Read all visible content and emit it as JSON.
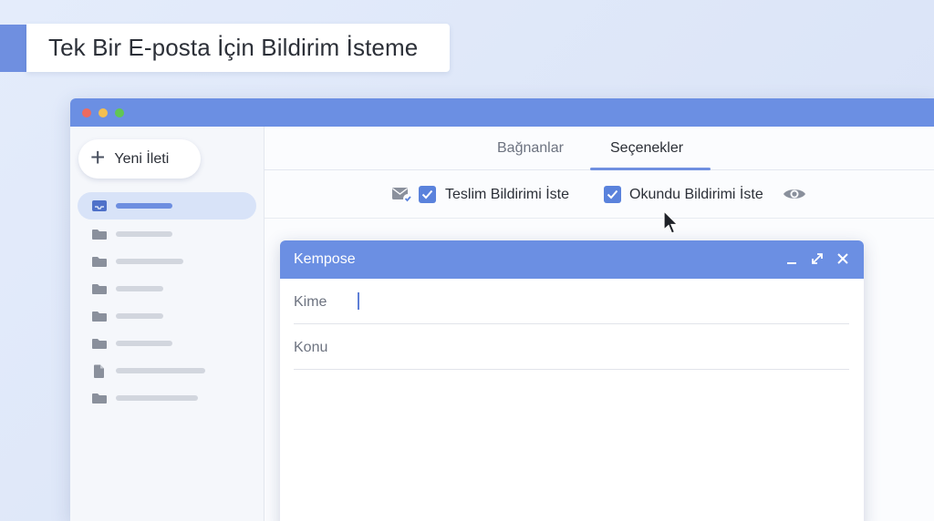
{
  "banner": {
    "title": "Tek Bir E-posta İçin Bildirim İsteme"
  },
  "window": {
    "controls": [
      "close",
      "minimize",
      "zoom"
    ]
  },
  "sidebar": {
    "new_message_label": "Yeni İleti",
    "items": [
      {
        "icon": "inbox-icon",
        "active": true
      },
      {
        "icon": "folder-icon",
        "active": false
      },
      {
        "icon": "folder-icon",
        "active": false
      },
      {
        "icon": "folder-icon",
        "active": false
      },
      {
        "icon": "folder-icon",
        "active": false
      },
      {
        "icon": "folder-icon",
        "active": false
      },
      {
        "icon": "document-icon",
        "active": false
      },
      {
        "icon": "folder-icon",
        "active": false
      }
    ]
  },
  "tabs": [
    {
      "label": "Bağnanlar",
      "active": false
    },
    {
      "label": "Seçenekler",
      "active": true
    }
  ],
  "options": {
    "delivery_receipt_label": "Teslim Bildirimi İste",
    "delivery_receipt_checked": true,
    "read_receipt_label": "Okundu Bildirimi İste",
    "read_receipt_checked": true
  },
  "compose": {
    "title": "Kempose",
    "to_label": "Kime",
    "to_value": "",
    "subject_label": "Konu",
    "subject_value": ""
  },
  "colors": {
    "accent": "#6b8fe3",
    "checkbox": "#5a82dc",
    "background": "#e0e8f9"
  }
}
